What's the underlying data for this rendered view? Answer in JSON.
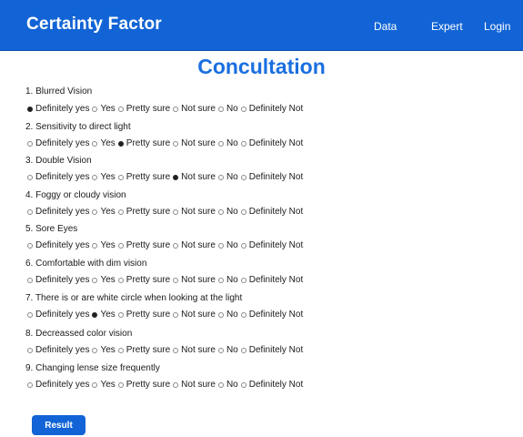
{
  "nav": {
    "brand": "Certainty Factor",
    "links": [
      "Data",
      "Expert",
      "Login"
    ]
  },
  "page_title": "Concultation",
  "options": [
    "Definitely yes",
    "Yes",
    "Pretty sure",
    "Not sure",
    "No",
    "Definitely Not"
  ],
  "questions": [
    {
      "label": "1. Blurred Vision",
      "selected": 0
    },
    {
      "label": "2. Sensitivity to direct light",
      "selected": 2
    },
    {
      "label": "3. Double Vision",
      "selected": 3
    },
    {
      "label": "4. Foggy or cloudy vision",
      "selected": -1
    },
    {
      "label": "5. Sore Eyes",
      "selected": -1
    },
    {
      "label": "6. Comfortable with dim vision",
      "selected": -1
    },
    {
      "label": "7. There is or are white circle when looking at the light",
      "selected": 1
    },
    {
      "label": "8. Decreassed color vision",
      "selected": -1
    },
    {
      "label": "9. Changing lense size frequently",
      "selected": -1
    }
  ],
  "result_button": "Result",
  "colors": {
    "primary": "#1264d6",
    "title": "#1a6fe0"
  }
}
